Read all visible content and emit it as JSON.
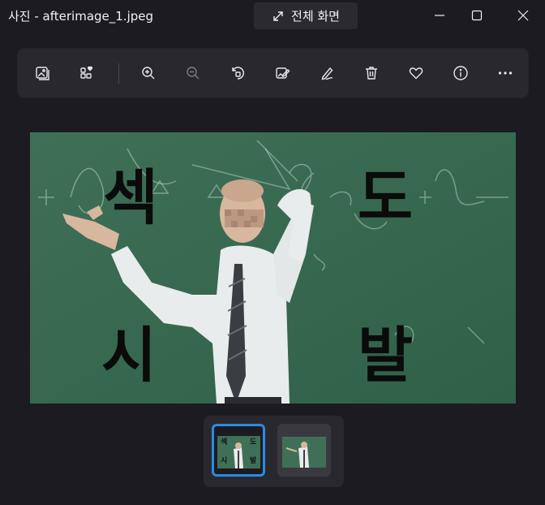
{
  "window": {
    "title": "사진 - afterimage_1.jpeg",
    "fullscreen_label": "전체 화면"
  },
  "toolbar": {
    "tools": [
      "view-all-photos-icon",
      "add-to-album-icon",
      "zoom-in-icon",
      "zoom-out-icon",
      "rotate-icon",
      "edit-image-icon",
      "draw-icon",
      "delete-icon",
      "favorite-icon",
      "info-icon",
      "more-options-icon"
    ]
  },
  "photo": {
    "captions": [
      "섹",
      "도",
      "시",
      "발"
    ]
  },
  "filmstrip": {
    "count": 2,
    "selected_index": 0,
    "accent": "#2b8be6"
  }
}
